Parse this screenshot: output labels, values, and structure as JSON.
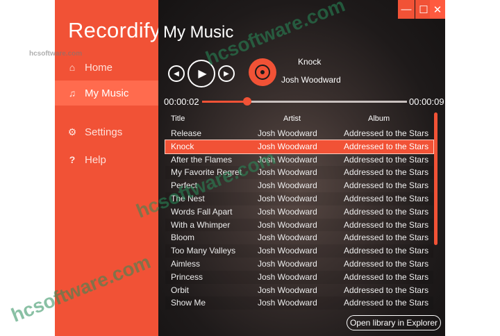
{
  "app": {
    "name": "Recordify"
  },
  "window": {
    "minimize": "—",
    "maximize": "☐",
    "close": "✕"
  },
  "sidebar": {
    "items": [
      {
        "label": "Home",
        "icon": "home-icon"
      },
      {
        "label": "My Music",
        "icon": "music-icon"
      },
      {
        "label": "Settings",
        "icon": "gear-icon"
      },
      {
        "label": "Help",
        "icon": "question-icon"
      }
    ]
  },
  "page": {
    "title": "My Music"
  },
  "player": {
    "now_playing_title": "Knock",
    "now_playing_artist": "Josh Woodward",
    "current_time": "00:00:02",
    "total_time": "00:00:09",
    "progress": 0.22
  },
  "table": {
    "headers": {
      "title": "Title",
      "artist": "Artist",
      "album": "Album"
    },
    "rows": [
      {
        "title": "Release",
        "artist": "Josh Woodward",
        "album": "Addressed to the Stars"
      },
      {
        "title": "Knock",
        "artist": "Josh Woodward",
        "album": "Addressed to the Stars"
      },
      {
        "title": "After the Flames",
        "artist": "Josh Woodward",
        "album": "Addressed to the Stars"
      },
      {
        "title": "My Favorite Regret",
        "artist": "Josh Woodward",
        "album": "Addressed to the Stars"
      },
      {
        "title": "Perfect",
        "artist": "Josh Woodward",
        "album": "Addressed to the Stars"
      },
      {
        "title": "The Nest",
        "artist": "Josh Woodward",
        "album": "Addressed to the Stars"
      },
      {
        "title": "Words Fall Apart",
        "artist": "Josh Woodward",
        "album": "Addressed to the Stars"
      },
      {
        "title": "With a Whimper",
        "artist": "Josh Woodward",
        "album": "Addressed to the Stars"
      },
      {
        "title": "Bloom",
        "artist": "Josh Woodward",
        "album": "Addressed to the Stars"
      },
      {
        "title": "Too Many Valleys",
        "artist": "Josh Woodward",
        "album": "Addressed to the Stars"
      },
      {
        "title": "Aimless",
        "artist": "Josh Woodward",
        "album": "Addressed to the Stars"
      },
      {
        "title": "Princess",
        "artist": "Josh Woodward",
        "album": "Addressed to the Stars"
      },
      {
        "title": "Orbit",
        "artist": "Josh Woodward",
        "album": "Addressed to the Stars"
      },
      {
        "title": "Show Me",
        "artist": "Josh Woodward",
        "album": "Addressed to the Stars"
      }
    ],
    "selected_index": 1
  },
  "footer": {
    "open_library_label": "Open library in Explorer"
  },
  "watermark": {
    "text": "hcsoftware.com",
    "small_text": "hcsoftware.com"
  },
  "colors": {
    "accent": "#f15236",
    "active_nav": "#ff6b4e",
    "background": "#1e1a1a"
  }
}
